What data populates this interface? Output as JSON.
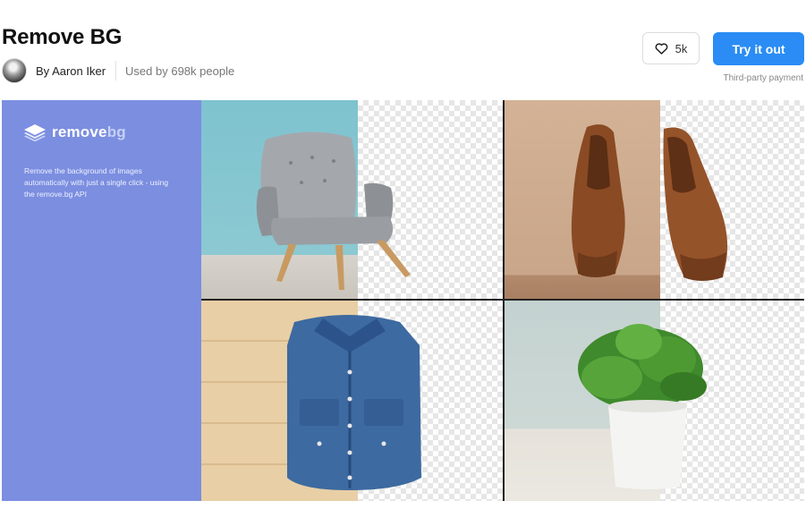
{
  "header": {
    "title": "Remove BG",
    "author": "By Aaron Iker",
    "used_by": "Used by 698k people"
  },
  "actions": {
    "like_count": "5k",
    "try_label": "Try it out",
    "payment_note": "Third-party payment",
    "try_color": "#2a8cf4"
  },
  "banner": {
    "brand_bold": "remove",
    "brand_light": "bg",
    "description": "Remove the background of images automatically with just a single click - using the remove.bg API",
    "side_color": "#7b8ee0",
    "images": [
      "chair",
      "shoes",
      "denim-shirt",
      "potted-plant"
    ]
  }
}
